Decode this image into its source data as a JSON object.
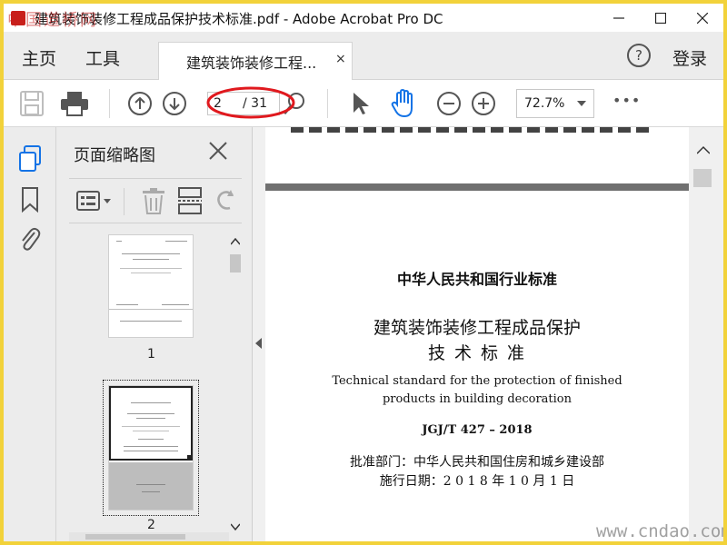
{
  "window": {
    "title": "建筑装饰装修工程成品保护技术标准.pdf - Adobe Acrobat Pro DC"
  },
  "menubar": {
    "home_label": "主页",
    "tools_label": "工具",
    "tab_label": "建筑装饰装修工程...",
    "tab_close": "×",
    "help_icon": "?",
    "login_label": "登录"
  },
  "toolbar": {
    "page_current": "2",
    "page_total": "/ 31",
    "zoom_value": "72.7%",
    "more_icon": "•••"
  },
  "panel": {
    "title": "页面缩略图",
    "thumbnails": [
      {
        "number": "1",
        "selected": false
      },
      {
        "number": "2",
        "selected": true
      }
    ]
  },
  "document": {
    "category": "中华人民共和国行业标准",
    "title_line1": "建筑装饰装修工程成品保护",
    "title_line2": "技  术  标  准",
    "english_line1": "Technical standard for the protection of finished",
    "english_line2": "products in building decoration",
    "code": "JGJ/T 427 – 2018",
    "approver": "批准部门：中华人民共和国住房和城乡建设部",
    "effective_date": "施行日期：2 0 1 8 年 1 0 月 1 日"
  },
  "watermarks": {
    "top_left": "中国道桥网",
    "bottom_right": "www.cndao.com"
  },
  "colors": {
    "frame": "#f2d23a",
    "accent_blue": "#1473e6",
    "annotation_red": "#e0191e"
  }
}
